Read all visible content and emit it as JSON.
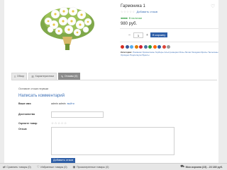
{
  "product": {
    "title": "Гармоника 1",
    "stars": "☆☆☆☆☆",
    "add_review_link": "Добавить отзыв",
    "stock_dots": "●●●●●",
    "stock_label": "В наличии",
    "price": "980 руб.",
    "qty_minus": "–",
    "qty_value": "1",
    "qty_plus": "+",
    "add_to_cart": "В корзину"
  },
  "social_colors": [
    "#d62b1f",
    "#3b5998",
    "#55acee",
    "#e07b00",
    "#cf2030",
    "#4c75a3",
    "#2a9c3a",
    "#ff6600",
    "#2f5fa7",
    "#db4437",
    "#999999"
  ],
  "categories": {
    "label": "Категории:",
    "items": "Ромашки Хризантемы Герберы Альстромерии Розы Лилии Гвоздики Ирисы Тюльпаны Орхидеи Подсолнухи Букеты"
  },
  "tabs": [
    {
      "label": "Обзор",
      "icon": "≡"
    },
    {
      "label": "Характеристики",
      "icon": "☰"
    },
    {
      "label": "Отзывы (0)",
      "icon": "✎"
    }
  ],
  "reviews": {
    "empty_text": "Оставьте отзыв первым",
    "form_title": "Написать комментарий",
    "name_label": "Ваше имя",
    "name_value": "admin admin",
    "edit_link": "выйти",
    "adv_label": "Достоинства",
    "rate_label": "Оцените товар",
    "rate_stars": "☆☆☆☆☆",
    "review_label": "Отзыв",
    "submit_label": "Добавить отзыв"
  },
  "bottom_bar": {
    "compare": "Сравнить товары (0)",
    "favorites": "Избранные товары (0)",
    "viewed": "Просмотренные товары (0)",
    "cart": "Моя корзина (23) - 23 180 руб."
  }
}
